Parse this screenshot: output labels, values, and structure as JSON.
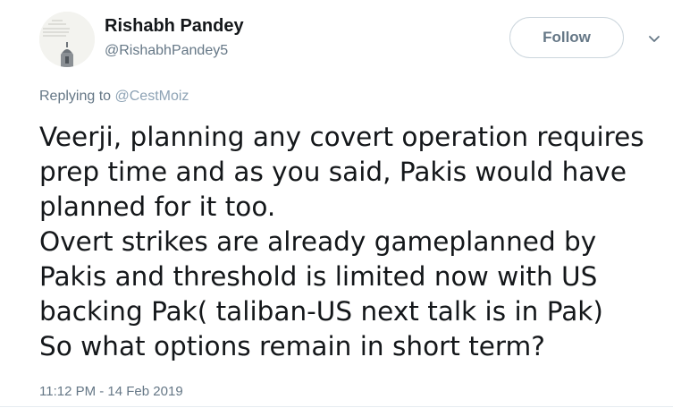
{
  "author": {
    "display_name": "Rishabh Pandey",
    "handle": "@RishabhPandey5",
    "avatar_icon": "profile-photo-avatar"
  },
  "follow": {
    "label": "Follow"
  },
  "menu": {
    "icon": "chevron-down-icon"
  },
  "reply": {
    "prefix": "Replying to ",
    "to": "@CestMoiz"
  },
  "tweet": {
    "text": "Veerji, planning any covert operation requires prep time and as you said, Pakis would have planned for it too.\nOvert strikes are already gameplanned by Pakis and threshold is limited now with US backing Pak( taliban-US next talk is in Pak)\nSo what options remain in short term?",
    "timestamp": "11:12 PM - 14 Feb 2019"
  },
  "colors": {
    "text": "#14171a",
    "secondary": "#657786",
    "border": "#ccd6dd"
  }
}
